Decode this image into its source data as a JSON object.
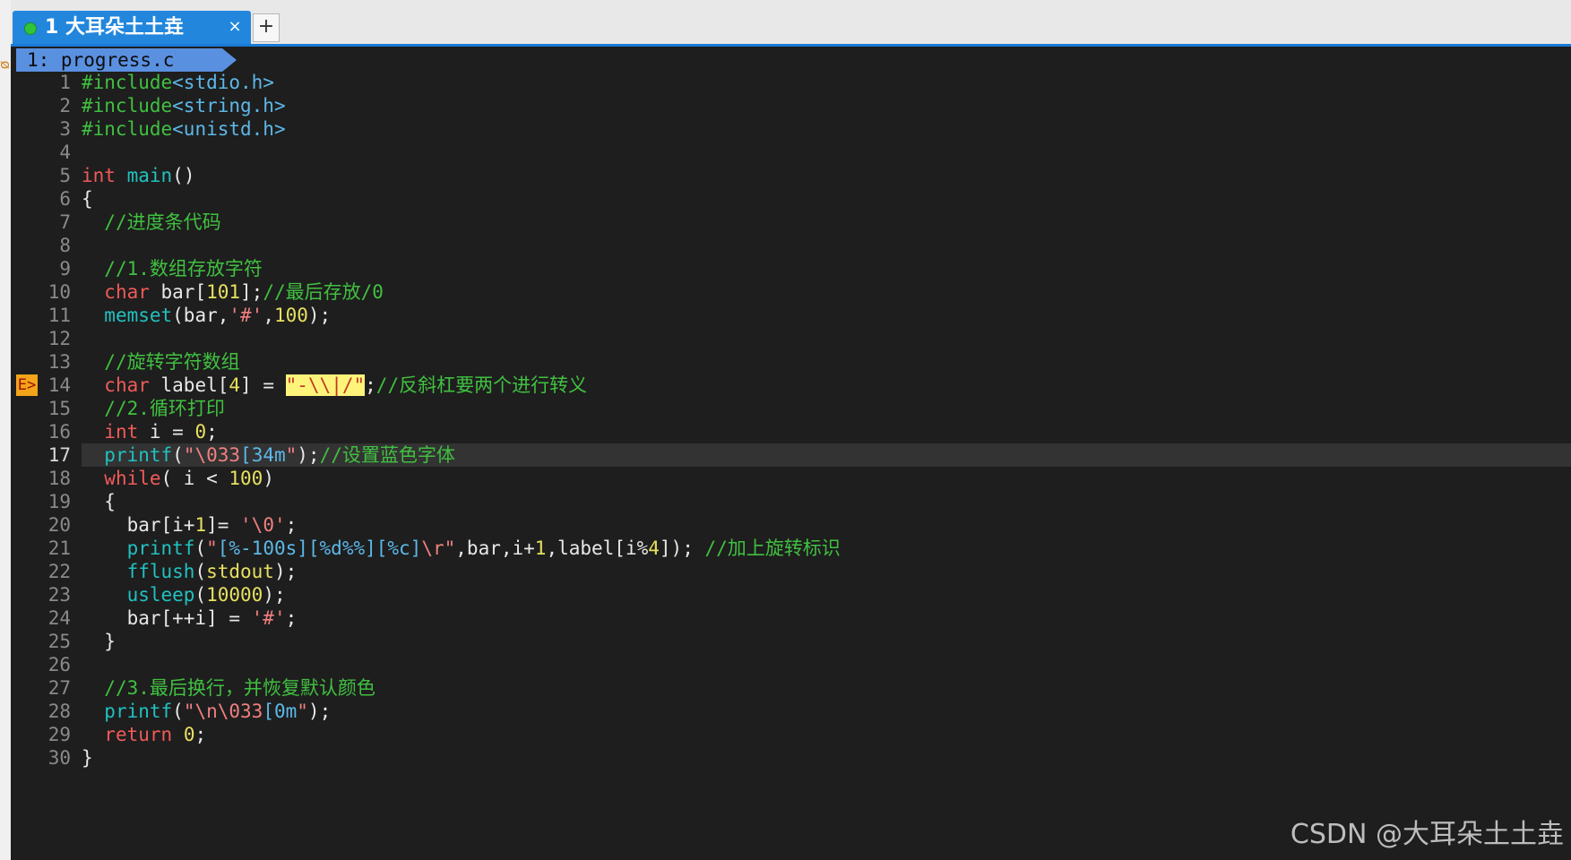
{
  "tab_bar": {
    "active_tab": {
      "label": "1 大耳朵土土垚",
      "status_color": "#31c43a",
      "close_symbol": "×"
    },
    "new_tab_symbol": "+"
  },
  "left_strip": {
    "icon_glyph": "ᴓ"
  },
  "editor": {
    "file_tab": "1: progress.c",
    "current_line": 17,
    "sign_line": 14,
    "sign_label": "E>",
    "lines": [
      {
        "n": "1",
        "tokens": [
          {
            "t": "#include",
            "c": "green"
          },
          {
            "t": "<stdio.h>",
            "c": "cyan"
          }
        ]
      },
      {
        "n": "2",
        "tokens": [
          {
            "t": "#include",
            "c": "green"
          },
          {
            "t": "<string.h>",
            "c": "cyan"
          }
        ]
      },
      {
        "n": "3",
        "tokens": [
          {
            "t": "#include",
            "c": "green"
          },
          {
            "t": "<unistd.h>",
            "c": "cyan"
          }
        ]
      },
      {
        "n": "4",
        "tokens": []
      },
      {
        "n": "5",
        "tokens": [
          {
            "t": "int",
            "c": "red"
          },
          {
            "t": " ",
            "c": "white"
          },
          {
            "t": "main",
            "c": "teal"
          },
          {
            "t": "()",
            "c": "white"
          }
        ]
      },
      {
        "n": "6",
        "tokens": [
          {
            "t": "{",
            "c": "white"
          }
        ]
      },
      {
        "n": "7",
        "tokens": [
          {
            "t": "  ",
            "c": "white"
          },
          {
            "t": "//进度条代码",
            "c": "green"
          }
        ]
      },
      {
        "n": "8",
        "tokens": []
      },
      {
        "n": "9",
        "tokens": [
          {
            "t": "  ",
            "c": "white"
          },
          {
            "t": "//1.数组存放字符",
            "c": "green"
          }
        ]
      },
      {
        "n": "10",
        "tokens": [
          {
            "t": "  ",
            "c": "white"
          },
          {
            "t": "char",
            "c": "red"
          },
          {
            "t": " bar[",
            "c": "white"
          },
          {
            "t": "101",
            "c": "yellow"
          },
          {
            "t": "];",
            "c": "white"
          },
          {
            "t": "//最后存放/0",
            "c": "green"
          }
        ]
      },
      {
        "n": "11",
        "tokens": [
          {
            "t": "  ",
            "c": "white"
          },
          {
            "t": "memset",
            "c": "teal"
          },
          {
            "t": "(bar,",
            "c": "white"
          },
          {
            "t": "'#'",
            "c": "pink"
          },
          {
            "t": ",",
            "c": "white"
          },
          {
            "t": "100",
            "c": "yellow"
          },
          {
            "t": ");",
            "c": "white"
          }
        ]
      },
      {
        "n": "12",
        "tokens": []
      },
      {
        "n": "13",
        "tokens": [
          {
            "t": "  ",
            "c": "white"
          },
          {
            "t": "//旋转字符数组",
            "c": "green"
          }
        ]
      },
      {
        "n": "14",
        "tokens": [
          {
            "t": "  ",
            "c": "white"
          },
          {
            "t": "char",
            "c": "red"
          },
          {
            "t": " label[",
            "c": "white"
          },
          {
            "t": "4",
            "c": "yellow"
          },
          {
            "t": "] = ",
            "c": "white"
          },
          {
            "t": "\"-\\\\|/\"",
            "c": "hl"
          },
          {
            "t": ";",
            "c": "white"
          },
          {
            "t": "//反斜杠要两个进行转义",
            "c": "green"
          }
        ]
      },
      {
        "n": "15",
        "tokens": [
          {
            "t": "  ",
            "c": "white"
          },
          {
            "t": "//2.循环打印",
            "c": "green"
          }
        ]
      },
      {
        "n": "16",
        "tokens": [
          {
            "t": "  ",
            "c": "white"
          },
          {
            "t": "int",
            "c": "red"
          },
          {
            "t": " i = ",
            "c": "white"
          },
          {
            "t": "0",
            "c": "yellow"
          },
          {
            "t": ";",
            "c": "white"
          }
        ]
      },
      {
        "n": "17",
        "tokens": [
          {
            "t": "  ",
            "c": "white"
          },
          {
            "t": "printf",
            "c": "teal"
          },
          {
            "t": "(",
            "c": "white"
          },
          {
            "t": "\"",
            "c": "pink"
          },
          {
            "t": "\\033",
            "c": "pink"
          },
          {
            "t": "[34m",
            "c": "cyan"
          },
          {
            "t": "\"",
            "c": "pink"
          },
          {
            "t": ");",
            "c": "white"
          },
          {
            "t": "//设置蓝色字体",
            "c": "green"
          }
        ]
      },
      {
        "n": "18",
        "tokens": [
          {
            "t": "  ",
            "c": "white"
          },
          {
            "t": "while",
            "c": "red"
          },
          {
            "t": "( i < ",
            "c": "white"
          },
          {
            "t": "100",
            "c": "yellow"
          },
          {
            "t": ")",
            "c": "white"
          }
        ]
      },
      {
        "n": "19",
        "tokens": [
          {
            "t": "  {",
            "c": "white"
          }
        ]
      },
      {
        "n": "20",
        "tokens": [
          {
            "t": "    bar[i+",
            "c": "white"
          },
          {
            "t": "1",
            "c": "yellow"
          },
          {
            "t": "]= ",
            "c": "white"
          },
          {
            "t": "'\\0'",
            "c": "pink"
          },
          {
            "t": ";",
            "c": "white"
          }
        ]
      },
      {
        "n": "21",
        "tokens": [
          {
            "t": "    ",
            "c": "white"
          },
          {
            "t": "printf",
            "c": "teal"
          },
          {
            "t": "(",
            "c": "white"
          },
          {
            "t": "\"",
            "c": "pink"
          },
          {
            "t": "[%-100s][%d%%][%c]",
            "c": "cyan"
          },
          {
            "t": "\\r",
            "c": "pink"
          },
          {
            "t": "\"",
            "c": "pink"
          },
          {
            "t": ",bar,i+",
            "c": "white"
          },
          {
            "t": "1",
            "c": "yellow"
          },
          {
            "t": ",label[i%",
            "c": "white"
          },
          {
            "t": "4",
            "c": "yellow"
          },
          {
            "t": "]); ",
            "c": "white"
          },
          {
            "t": "//加上旋转标识",
            "c": "green"
          }
        ]
      },
      {
        "n": "22",
        "tokens": [
          {
            "t": "    ",
            "c": "white"
          },
          {
            "t": "fflush",
            "c": "teal"
          },
          {
            "t": "(",
            "c": "white"
          },
          {
            "t": "stdout",
            "c": "yellow"
          },
          {
            "t": ");",
            "c": "white"
          }
        ]
      },
      {
        "n": "23",
        "tokens": [
          {
            "t": "    ",
            "c": "white"
          },
          {
            "t": "usleep",
            "c": "teal"
          },
          {
            "t": "(",
            "c": "white"
          },
          {
            "t": "10000",
            "c": "yellow"
          },
          {
            "t": ");",
            "c": "white"
          }
        ]
      },
      {
        "n": "24",
        "tokens": [
          {
            "t": "    bar[++i] = ",
            "c": "white"
          },
          {
            "t": "'#'",
            "c": "pink"
          },
          {
            "t": ";",
            "c": "white"
          }
        ]
      },
      {
        "n": "25",
        "tokens": [
          {
            "t": "  }",
            "c": "white"
          }
        ]
      },
      {
        "n": "26",
        "tokens": []
      },
      {
        "n": "27",
        "tokens": [
          {
            "t": "  ",
            "c": "white"
          },
          {
            "t": "//3.最后换行，并恢复默认颜色",
            "c": "green"
          }
        ]
      },
      {
        "n": "28",
        "tokens": [
          {
            "t": "  ",
            "c": "white"
          },
          {
            "t": "printf",
            "c": "teal"
          },
          {
            "t": "(",
            "c": "white"
          },
          {
            "t": "\"",
            "c": "pink"
          },
          {
            "t": "\\n\\033",
            "c": "pink"
          },
          {
            "t": "[0m",
            "c": "cyan"
          },
          {
            "t": "\"",
            "c": "pink"
          },
          {
            "t": ");",
            "c": "white"
          }
        ]
      },
      {
        "n": "29",
        "tokens": [
          {
            "t": "  ",
            "c": "white"
          },
          {
            "t": "return",
            "c": "red"
          },
          {
            "t": " ",
            "c": "white"
          },
          {
            "t": "0",
            "c": "yellow"
          },
          {
            "t": ";",
            "c": "white"
          }
        ]
      },
      {
        "n": "30",
        "tokens": [
          {
            "t": "}",
            "c": "white"
          }
        ]
      }
    ]
  },
  "watermark": "CSDN @大耳朵土土垚",
  "colors": {
    "accent": "#2287dc",
    "terminal_bg": "#1e1e1e",
    "file_tab_bg": "#5a90e0",
    "current_line_bg": "#333333",
    "sign_bg": "#f2a51a"
  }
}
